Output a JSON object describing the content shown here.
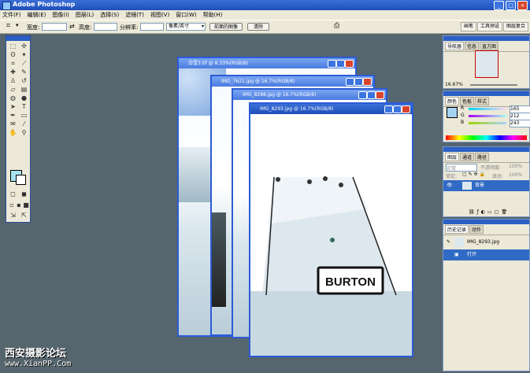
{
  "app": {
    "title": "Adobe Photoshop"
  },
  "menu": [
    "文件(F)",
    "编辑(E)",
    "图像(I)",
    "图层(L)",
    "选择(S)",
    "滤镜(T)",
    "视图(V)",
    "窗口(W)",
    "帮助(H)"
  ],
  "options": {
    "width_label": "宽度:",
    "height_label": "高度:",
    "resolution_label": "分辨率:",
    "unit_value": "像素/英寸",
    "front_image_button": "前面的图像",
    "clear_button": "清除"
  },
  "palette_well": [
    "画笔",
    "工具预设",
    "图层复合"
  ],
  "documents": [
    {
      "title": "白雪3.tif @ 8.33%(RGB/8)"
    },
    {
      "title": "IMG_7621.jpg @ 16.7%(RGB/8)"
    },
    {
      "title": "IMG_8298.jpg @ 16.7%(RGB/8)"
    },
    {
      "title": "IMG_8293.jpg @ 16.7%(RGB/8)"
    }
  ],
  "sign_text": "BURTON",
  "navigator": {
    "tabs": [
      "导航器",
      "信息",
      "直方图"
    ],
    "zoom": "16.67%"
  },
  "color": {
    "tabs": [
      "颜色",
      "色板",
      "样式"
    ],
    "rows": [
      {
        "channel": "R",
        "value": "165"
      },
      {
        "channel": "G",
        "value": "212"
      },
      {
        "channel": "B",
        "value": "243"
      }
    ],
    "fg": "#a5d4f3"
  },
  "layers": {
    "tabs": [
      "图层",
      "通道",
      "路径"
    ],
    "mode": "正常",
    "opacity_label": "不透明度:",
    "opacity": "100%",
    "lock_label": "锁定:",
    "fill_label": "填充:",
    "fill": "100%",
    "layer_name": "背景"
  },
  "history": {
    "tabs": [
      "历史记录",
      "动作"
    ],
    "snapshot": "IMG_8293.jpg",
    "step": "打开"
  },
  "watermark": {
    "line1": "西安摄影论坛",
    "line2": "www.XianPP.Com"
  }
}
